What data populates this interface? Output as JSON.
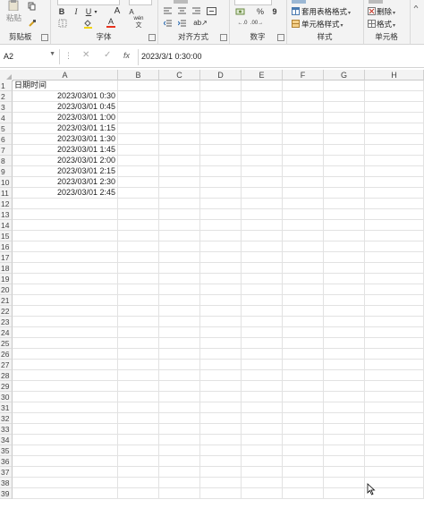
{
  "ribbon": {
    "clipboard": {
      "label": "剪贴板",
      "paste": "粘贴"
    },
    "font": {
      "label": "字体",
      "bold": "B",
      "italic": "I",
      "underline": "U",
      "grow": "A",
      "shrink": "A",
      "font_color": "A",
      "phonetic": "wén"
    },
    "alignment": {
      "label": "对齐方式"
    },
    "number": {
      "label": "数字",
      "percent": "%",
      "comma": "9"
    },
    "styles": {
      "label": "样式",
      "table_format": "套用表格格式",
      "cell_styles": "单元格样式"
    },
    "cells": {
      "label": "单元格",
      "delete": "删除",
      "format": "格式"
    }
  },
  "formula_bar": {
    "name_box": "A2",
    "content": "2023/3/1  0:30:00",
    "fx": "fx"
  },
  "sheet": {
    "columns": [
      "A",
      "B",
      "C",
      "D",
      "E",
      "F",
      "G",
      "H"
    ],
    "rows": [
      "1",
      "2",
      "3",
      "4",
      "5",
      "6",
      "7",
      "8",
      "9",
      "10",
      "11",
      "12",
      "13",
      "14",
      "15",
      "16",
      "17",
      "18",
      "19",
      "20",
      "21",
      "22",
      "23",
      "24",
      "25",
      "26",
      "27",
      "28",
      "29",
      "30",
      "31",
      "32",
      "33",
      "34",
      "35",
      "36",
      "37",
      "38",
      "39"
    ],
    "header_cell": "日期时间",
    "column_a": [
      "2023/03/01 0:30",
      "2023/03/01 0:45",
      "2023/03/01 1:00",
      "2023/03/01 1:15",
      "2023/03/01 1:30",
      "2023/03/01 1:45",
      "2023/03/01 2:00",
      "2023/03/01 2:15",
      "2023/03/01 2:30",
      "2023/03/01 2:45"
    ]
  }
}
